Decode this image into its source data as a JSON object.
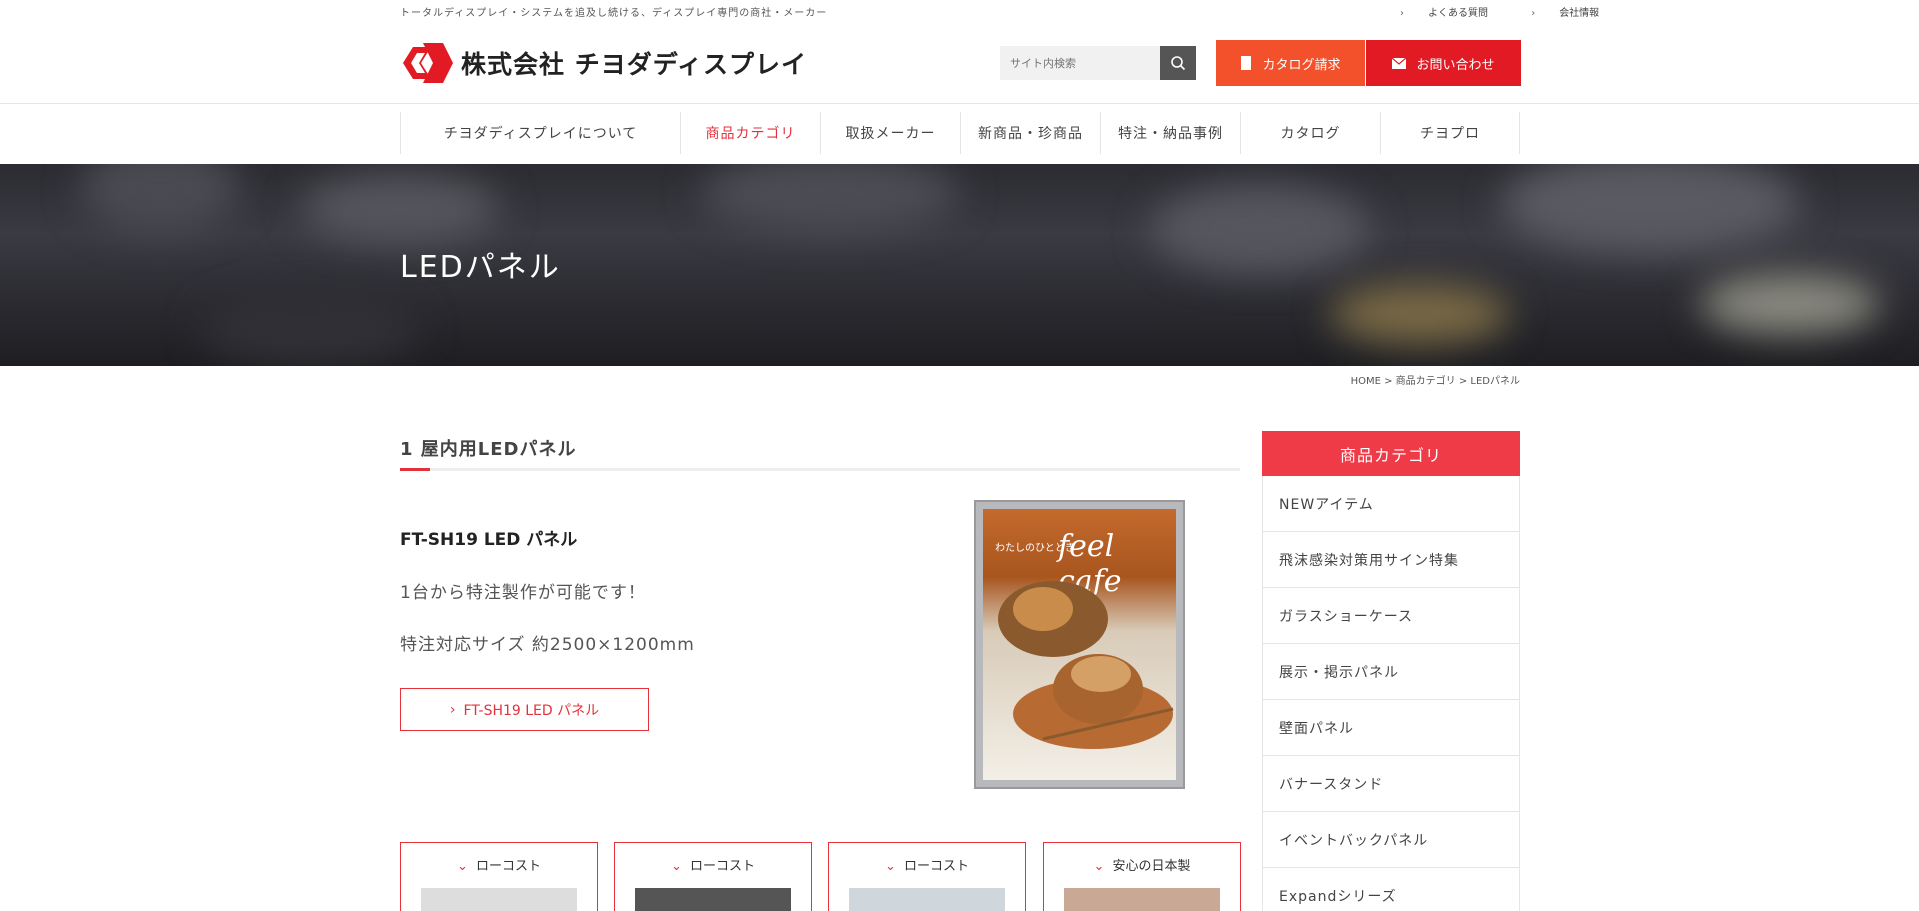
{
  "topbar": {
    "tagline": "トータルディスプレイ・システムを追及し続ける、ディスプレイ専門の商社・メーカー",
    "links": [
      {
        "label": "よくある質問"
      },
      {
        "label": "会社情報"
      }
    ]
  },
  "header": {
    "logo_text": "株式会社 チヨダディスプレイ",
    "search_placeholder": "サイト内検索",
    "catalog_label": "カタログ請求",
    "contact_label": "お問い合わせ",
    "colors": {
      "catalog": "#f3512b",
      "contact": "#e21a23",
      "accent": "#e5313a"
    }
  },
  "nav": {
    "items": [
      {
        "label": "チヨダディスプレイについて"
      },
      {
        "label": "商品カテゴリ"
      },
      {
        "label": "取扱メーカー"
      },
      {
        "label": "新商品・珍商品"
      },
      {
        "label": "特注・納品事例"
      },
      {
        "label": "カタログ"
      },
      {
        "label": "チヨプロ"
      }
    ]
  },
  "hero": {
    "title": "LEDパネル"
  },
  "breadcrumb": {
    "text": "HOME > 商品カテゴリ > LEDパネル"
  },
  "section": {
    "title": "1 屋内用LEDパネル",
    "product_name": "FT-SH19 LED パネル",
    "desc1": "1台から特注製作が可能です！",
    "desc2": "特注対応サイズ 約2500×1200mm",
    "link_label": "FT-SH19 LED パネル",
    "image_text": "feel cafe",
    "image_subtext": "わたしのひととき"
  },
  "cards": [
    {
      "label": "ローコスト"
    },
    {
      "label": "ローコスト"
    },
    {
      "label": "ローコスト"
    },
    {
      "label": "安心の日本製"
    }
  ],
  "sidebar": {
    "title": "商品カテゴリ",
    "items": [
      {
        "label": "NEWアイテム"
      },
      {
        "label": "飛沫感染対策用サイン特集"
      },
      {
        "label": "ガラスショーケース"
      },
      {
        "label": "展示・掲示パネル"
      },
      {
        "label": "壁面パネル"
      },
      {
        "label": "バナースタンド"
      },
      {
        "label": "イベントバックパネル"
      },
      {
        "label": "Expandシリーズ"
      }
    ]
  }
}
